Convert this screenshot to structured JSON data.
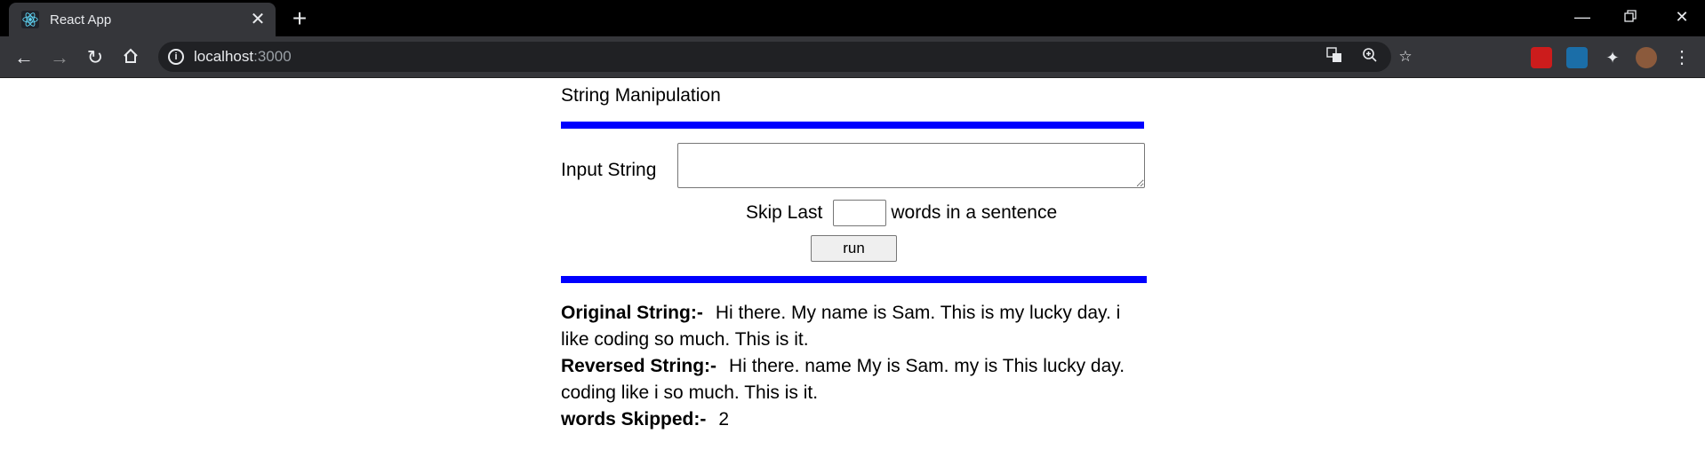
{
  "browser": {
    "tab_title": "React App",
    "new_tab_symbol": "+",
    "close_symbol": "✕",
    "url_host": "localhost",
    "url_port": ":3000"
  },
  "page": {
    "title": "String Manipulation",
    "input_label": "Input String",
    "input_value": "",
    "skip_prefix": "Skip Last",
    "skip_value": "",
    "skip_suffix": "words in a sentence",
    "run_label": "run",
    "accent_color": "#0000ff"
  },
  "results": {
    "original_label": "Original String:-",
    "original_value": "Hi there. My name is Sam. This is my lucky day. i like coding so much. This is it.",
    "reversed_label": "Reversed String:-",
    "reversed_value": "Hi there. name My is Sam. my is This lucky day. coding like i so much. This is it.",
    "skipped_label": "words Skipped:-",
    "skipped_value": "2"
  }
}
